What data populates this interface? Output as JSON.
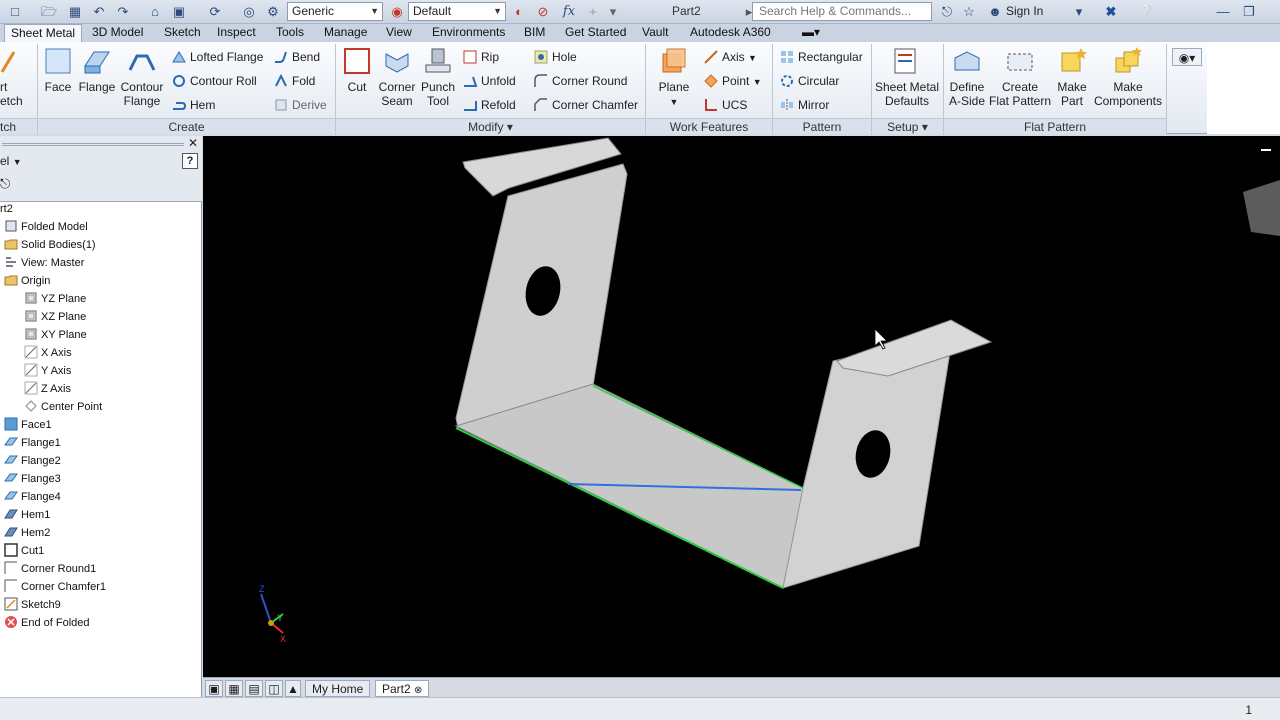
{
  "qat": {
    "material": "Generic",
    "appearance": "Default",
    "doc_title": "Part2",
    "search_placeholder": "Search Help & Commands...",
    "sign_in": "Sign In",
    "fx": "fx"
  },
  "tabs": [
    "Sheet Metal",
    "3D Model",
    "Sketch",
    "Inspect",
    "Tools",
    "Manage",
    "View",
    "Environments",
    "BIM",
    "Get Started",
    "Vault",
    "Autodesk A360"
  ],
  "ribbon": {
    "sketch_partial": [
      "rt",
      "etch"
    ],
    "sketch_group_partial": "tch",
    "create": {
      "label": "Create",
      "face": "Face",
      "flange": "Flange",
      "contour_flange": [
        "Contour",
        "Flange"
      ],
      "lofted_flange": "Lofted Flange",
      "contour_roll": "Contour Roll",
      "hem": "Hem",
      "bend": "Bend",
      "fold": "Fold",
      "derive": "Derive"
    },
    "modify": {
      "label": "Modify",
      "cut": "Cut",
      "corner_seam": [
        "Corner",
        "Seam"
      ],
      "punch_tool": [
        "Punch",
        "Tool"
      ],
      "rip": "Rip",
      "unfold": "Unfold",
      "refold": "Refold",
      "hole": "Hole",
      "corner_round": "Corner Round",
      "corner_chamfer": "Corner Chamfer"
    },
    "work_features": {
      "label": "Work Features",
      "plane": "Plane",
      "axis": "Axis",
      "point": "Point",
      "ucs": "UCS"
    },
    "pattern": {
      "label": "Pattern",
      "rectangular": "Rectangular",
      "circular": "Circular",
      "mirror": "Mirror"
    },
    "setup": {
      "label": "Setup",
      "sheet_metal_defaults": [
        "Sheet Metal",
        "Defaults"
      ]
    },
    "flat_pattern": {
      "label": "Flat Pattern",
      "define_a_side": [
        "Define",
        "A-Side"
      ],
      "create_flat_pattern": [
        "Create",
        "Flat Pattern"
      ],
      "make_part": [
        "Make",
        "Part"
      ],
      "make_components": [
        "Make",
        "Components"
      ]
    }
  },
  "browser": {
    "title_partial": "el",
    "root": "rt2",
    "items": [
      {
        "label": "Folded Model",
        "indent": 0,
        "icon": "folded-model"
      },
      {
        "label": "Solid Bodies(1)",
        "indent": 1,
        "icon": "folder"
      },
      {
        "label": "View: Master",
        "indent": 1,
        "icon": "view"
      },
      {
        "label": "Origin",
        "indent": 1,
        "icon": "folder"
      },
      {
        "label": "YZ Plane",
        "indent": 2,
        "icon": "plane"
      },
      {
        "label": "XZ Plane",
        "indent": 2,
        "icon": "plane"
      },
      {
        "label": "XY Plane",
        "indent": 2,
        "icon": "plane"
      },
      {
        "label": "X Axis",
        "indent": 2,
        "icon": "axis"
      },
      {
        "label": "Y Axis",
        "indent": 2,
        "icon": "axis"
      },
      {
        "label": "Z Axis",
        "indent": 2,
        "icon": "axis"
      },
      {
        "label": "Center Point",
        "indent": 2,
        "icon": "point"
      },
      {
        "label": "Face1",
        "indent": 1,
        "icon": "face"
      },
      {
        "label": "Flange1",
        "indent": 1,
        "icon": "flange"
      },
      {
        "label": "Flange2",
        "indent": 1,
        "icon": "flange"
      },
      {
        "label": "Flange3",
        "indent": 1,
        "icon": "flange"
      },
      {
        "label": "Flange4",
        "indent": 1,
        "icon": "flange"
      },
      {
        "label": "Hem1",
        "indent": 1,
        "icon": "hem"
      },
      {
        "label": "Hem2",
        "indent": 1,
        "icon": "hem"
      },
      {
        "label": "Cut1",
        "indent": 1,
        "icon": "cut"
      },
      {
        "label": "Corner Round1",
        "indent": 1,
        "icon": "corner"
      },
      {
        "label": "Corner Chamfer1",
        "indent": 1,
        "icon": "corner"
      },
      {
        "label": "Sketch9",
        "indent": 1,
        "icon": "sketch"
      },
      {
        "label": "End of Folded",
        "indent": 1,
        "icon": "end"
      }
    ]
  },
  "doc_tabs": {
    "home": "My Home",
    "part": "Part2"
  },
  "triad": {
    "x": "X",
    "y": "Y",
    "z": "Z"
  },
  "status": {
    "page": "1"
  }
}
